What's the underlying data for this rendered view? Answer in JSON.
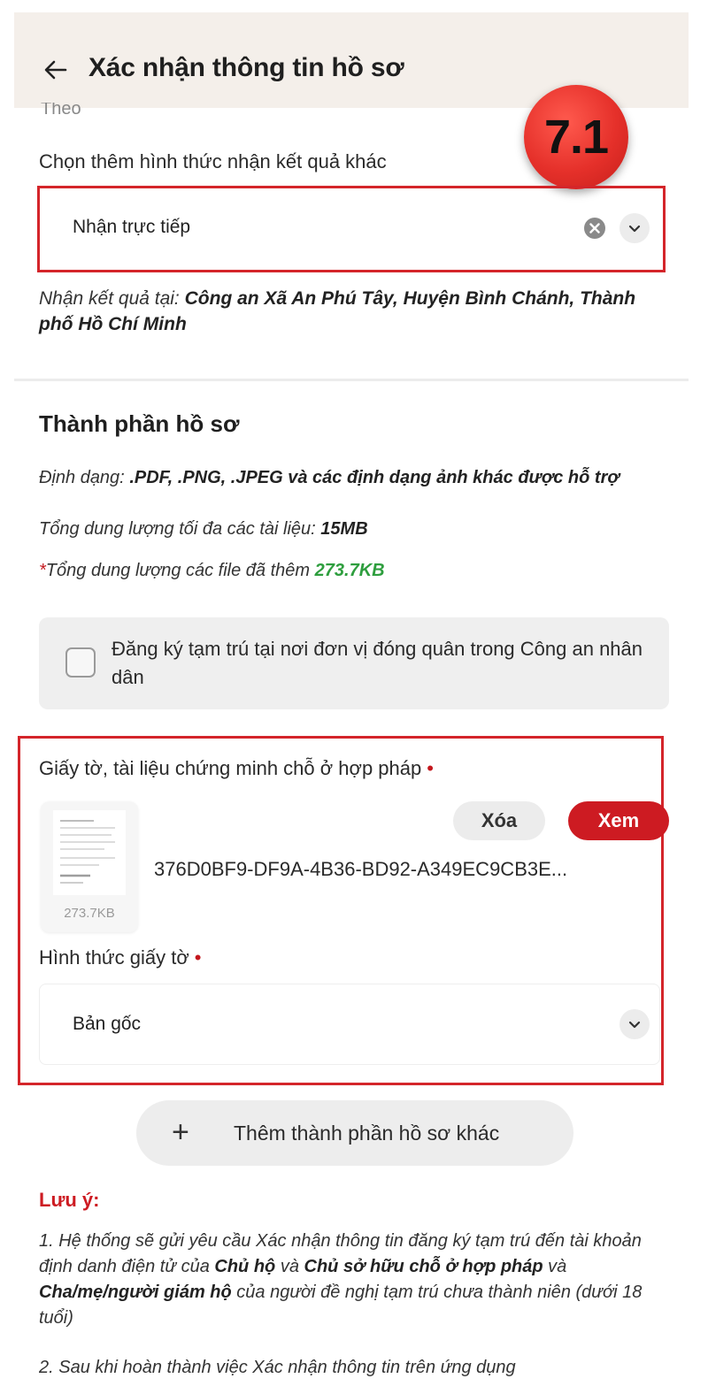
{
  "header": {
    "title": "Xác nhận thông tin hồ sơ",
    "back_icon": "arrow-left-icon"
  },
  "clipped_previous_text": "Theo",
  "step_badge": "7.1",
  "result_method": {
    "label": "Chọn thêm hình thức nhận kết quả khác",
    "value": "Nhận trực tiếp",
    "receive_at_prefix": "Nhận kết quả tại:",
    "receive_at_value": "Công an Xã An Phú Tây, Huyện Bình Chánh, Thành phố Hồ Chí Minh"
  },
  "documents": {
    "section_title": "Thành phần hồ sơ",
    "format_prefix": "Định dạng:",
    "format_value": ".PDF, .PNG, .JPEG và các định dạng ảnh khác được hỗ trợ",
    "max_size_prefix": "Tổng dung lượng tối đa các tài liệu:",
    "max_size_value": "15MB",
    "added_star": "*",
    "added_prefix": "Tổng dung lượng các file đã thêm",
    "added_value": "273.7KB",
    "checkbox_label": "Đăng ký tạm trú tại nơi đơn vị đóng quân trong Công an nhân dân",
    "checkbox_checked": false
  },
  "legal_residence_doc": {
    "label": "Giấy tờ, tài liệu chứng minh chỗ ở hợp pháp",
    "required_mark": "•",
    "thumbnail_size": "273.7KB",
    "delete_label": "Xóa",
    "view_label": "Xem",
    "file_name": "376D0BF9-DF9A-4B36-BD92-A349EC9CB3E...",
    "doc_type_label": "Hình thức giấy tờ",
    "doc_type_required_mark": "•",
    "doc_type_value": "Bản gốc"
  },
  "add_more": {
    "plus": "+",
    "label": "Thêm thành phần hồ sơ khác"
  },
  "notes": {
    "title": "Lưu ý:",
    "p1_a": "1. Hệ thống sẽ gửi yêu cầu Xác nhận thông tin đăng ký tạm trú đến tài khoản định danh điện tử của ",
    "p1_b": "Chủ hộ",
    "p1_c": " và ",
    "p1_d": "Chủ sở hữu chỗ ở hợp pháp",
    "p1_e": " và ",
    "p1_f": "Cha/mẹ/người giám hộ",
    "p1_g": " của người đề nghị tạm trú chưa thành niên (dưới 18 tuổi)",
    "p2": "2. Sau khi hoàn thành việc Xác nhận thông tin trên ứng dụng"
  },
  "colors": {
    "accent_red": "#cd1b22",
    "highlight_border": "#d4252a",
    "badge_red": "#e5302a",
    "green_value": "#2e9e3e",
    "header_bg": "#f4efea"
  }
}
